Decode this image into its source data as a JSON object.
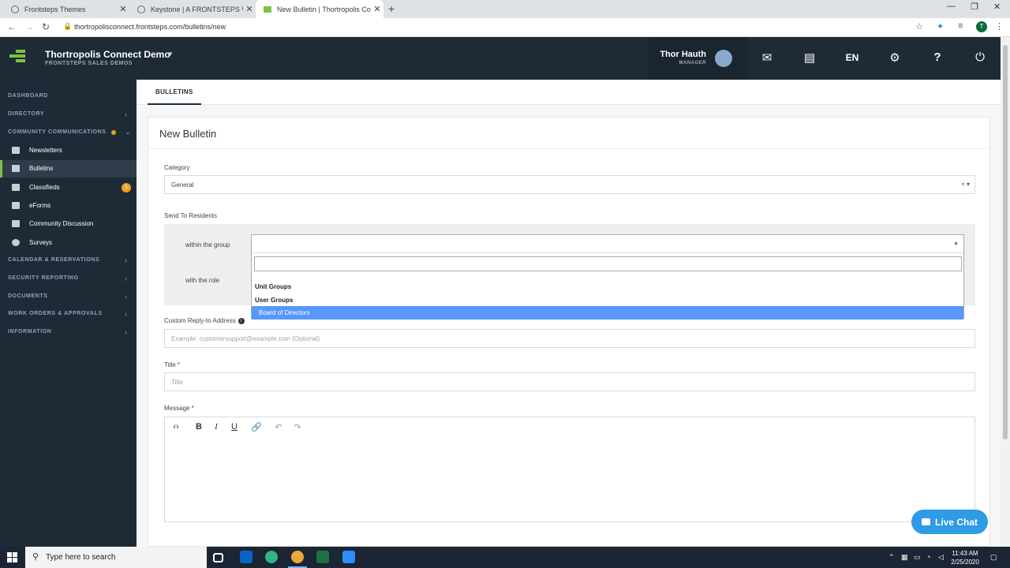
{
  "browser": {
    "tabs": [
      {
        "title": "Frontsteps Themes",
        "active": false
      },
      {
        "title": "Keystone | A FRONTSTEPS Word",
        "active": false
      },
      {
        "title": "New Bulletin | Thortropolis Conne",
        "active": true
      }
    ],
    "url": "thortropolisconnect.frontsteps.com/bulletins/new",
    "profile_initial": "T"
  },
  "header": {
    "org_name": "Thortropolis Connect Demo",
    "org_sub": "FRONTSTEPS SALES DEMOS",
    "user_name": "Thor Hauth",
    "user_role": "MANAGER",
    "language": "EN"
  },
  "sidebar": {
    "sections": {
      "dashboard": "DASHBOARD",
      "directory": "DIRECTORY",
      "community_communications": "COMMUNITY COMMUNICATIONS",
      "calendar": "CALENDAR & RESERVATIONS",
      "security": "SECURITY REPORTING",
      "documents": "DOCUMENTS",
      "work_orders": "WORK ORDERS & APPROVALS",
      "information": "INFORMATION"
    },
    "items": [
      {
        "label": "Newsletters",
        "icon": "newsletter-icon"
      },
      {
        "label": "Bulletins",
        "icon": "bulletin-icon",
        "active": true
      },
      {
        "label": "Classifieds",
        "icon": "classifieds-icon",
        "badge": "1"
      },
      {
        "label": "eForms",
        "icon": "eforms-icon"
      },
      {
        "label": "Community Discussion",
        "icon": "discussion-icon"
      },
      {
        "label": "Surveys",
        "icon": "surveys-icon"
      }
    ]
  },
  "main": {
    "subnav_tab": "BULLETINS",
    "title": "New Bulletin",
    "category_label": "Category",
    "category_value": "General",
    "send_to_label": "Send To Residents",
    "within_group_label": "within the group",
    "with_role_label": "with the role",
    "dropdown_options": [
      "Unit Groups",
      "User Groups",
      "Board of Directors"
    ],
    "reply_label": "Custom Reply-to Address",
    "reply_placeholder": "Example: customersupport@example.com (Optional)",
    "title_label": "Title *",
    "title_placeholder": "Title",
    "message_label": "Message *",
    "live_chat": "Live Chat"
  },
  "taskbar": {
    "search_placeholder": "Type here to search",
    "time": "11:43 AM",
    "date": "2/25/2020"
  },
  "colors": {
    "header_bg": "#1e2b37",
    "accent_green": "#7dc242",
    "highlight_blue": "#5897fb",
    "live_chat": "#2d9be6",
    "badge_orange": "#f0a020"
  }
}
